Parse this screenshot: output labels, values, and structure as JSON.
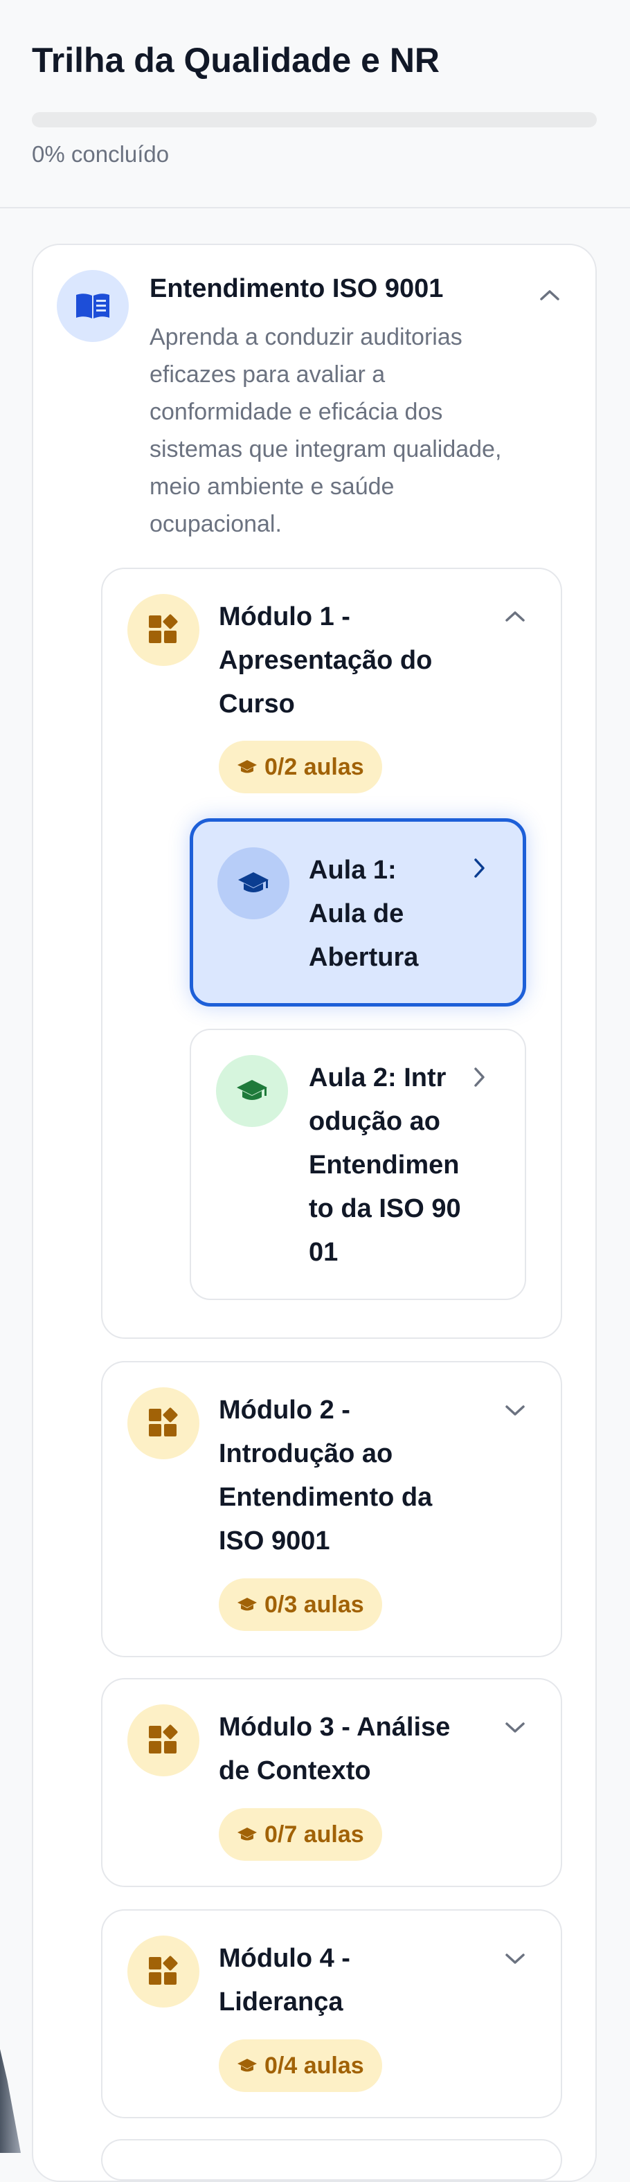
{
  "header": {
    "title": "Trilha da Qualidade e NR",
    "progress_percent": 0,
    "progress_label": "0% concluído"
  },
  "course": {
    "title": "Entendimento ISO 9001",
    "description": "Aprenda a conduzir auditorias eficazes para avaliar a conformidade e eficácia dos sistemas que integram qualidade, meio ambiente e saúde ocupacional.",
    "icon": "book-open-icon",
    "expanded": true
  },
  "modules": [
    {
      "title": "Módulo 1 - Apresentação do Curso",
      "badge": "0/2 aulas",
      "expanded": true,
      "lessons": [
        {
          "title": "Aula 1: Aula de Abertura",
          "state": "active"
        },
        {
          "title": "Aula 2: Introdução ao Entendimento da ISO 9001",
          "state": "available"
        }
      ]
    },
    {
      "title": "Módulo 2 - Introdução ao Entendimento da ISO 9001",
      "badge": "0/3 aulas",
      "expanded": false
    },
    {
      "title": "Módulo 3 - Análise de Contexto",
      "badge": "0/7 aulas",
      "expanded": false
    },
    {
      "title": "Módulo 4 - Liderança",
      "badge": "0/4 aulas",
      "expanded": false
    }
  ],
  "icons": {
    "module": "widgets-icon",
    "lesson": "graduation-cap-icon",
    "badge": "graduation-cap-icon",
    "expand": "chevron-down-icon",
    "collapse": "chevron-up-icon",
    "open": "chevron-right-icon"
  },
  "colors": {
    "accent": "#2563eb",
    "course_icon_bg": "#dbe7fe",
    "module_icon_bg": "#fdf0c6",
    "module_icon": "#a16207",
    "badge_text": "#a16207",
    "active_lesson_bg": "#dbe7fe",
    "active_lesson_border": "#1d5fd8",
    "lesson_icon_blue": "#0b3d91",
    "lesson_icon_green": "#1e7a3a",
    "text_primary": "#111827",
    "text_secondary": "#6b7280"
  }
}
